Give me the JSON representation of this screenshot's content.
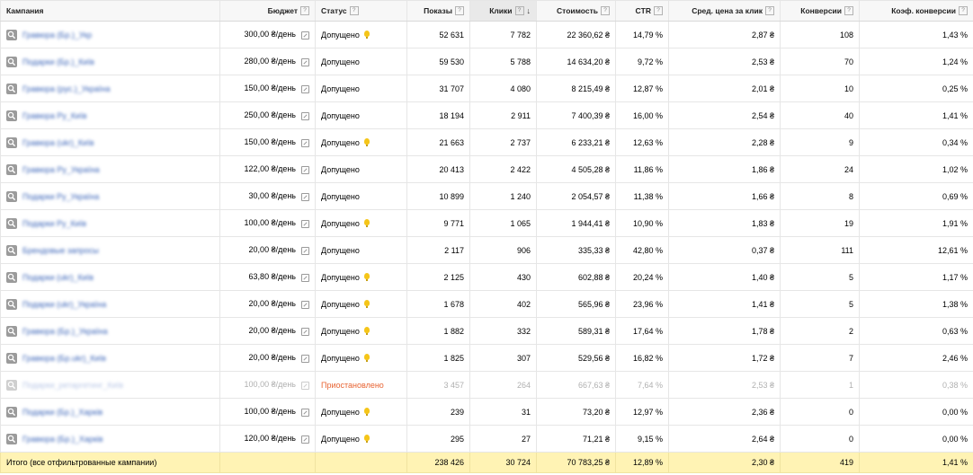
{
  "headers": {
    "campaign": "Кампания",
    "budget": "Бюджет",
    "status": "Статус",
    "impressions": "Показы",
    "clicks": "Клики",
    "cost": "Стоимость",
    "ctr": "CTR",
    "avg_cpc": "Сред. цена за клик",
    "conversions": "Конверсии",
    "conv_rate": "Коэф. конверсии",
    "help_mark": "?",
    "sort_arrow": "↓"
  },
  "icons": {
    "search": "search-icon",
    "edit": "pencil-edit-icon",
    "bulb": "lightbulb-icon"
  },
  "colors": {
    "link": "#3a64b8",
    "paused_status": "#e86433",
    "total_row": "#fff3b4",
    "bulb": "#f5c518"
  },
  "rows": [
    {
      "name": "Гравюра (Бр.)_Укр",
      "budget": "300,00 ₴/день",
      "status": "Допущено",
      "bulb": true,
      "impressions": "52 631",
      "clicks": "7 782",
      "cost": "22 360,62 ₴",
      "ctr": "14,79 %",
      "cpc": "2,87 ₴",
      "conv": "108",
      "rate": "1,43 %",
      "paused": false
    },
    {
      "name": "Подарки (Бр.)_Київ",
      "budget": "280,00 ₴/день",
      "status": "Допущено",
      "bulb": false,
      "impressions": "59 530",
      "clicks": "5 788",
      "cost": "14 634,20 ₴",
      "ctr": "9,72 %",
      "cpc": "2,53 ₴",
      "conv": "70",
      "rate": "1,24 %",
      "paused": false
    },
    {
      "name": "Гравюра (рус.)_Україна",
      "budget": "150,00 ₴/день",
      "status": "Допущено",
      "bulb": false,
      "impressions": "31 707",
      "clicks": "4 080",
      "cost": "8 215,49 ₴",
      "ctr": "12,87 %",
      "cpc": "2,01 ₴",
      "conv": "10",
      "rate": "0,25 %",
      "paused": false
    },
    {
      "name": "Гравюра Ру_Київ",
      "budget": "250,00 ₴/день",
      "status": "Допущено",
      "bulb": false,
      "impressions": "18 194",
      "clicks": "2 911",
      "cost": "7 400,39 ₴",
      "ctr": "16,00 %",
      "cpc": "2,54 ₴",
      "conv": "40",
      "rate": "1,41 %",
      "paused": false
    },
    {
      "name": "Гравюра (ukr)_Київ",
      "budget": "150,00 ₴/день",
      "status": "Допущено",
      "bulb": true,
      "impressions": "21 663",
      "clicks": "2 737",
      "cost": "6 233,21 ₴",
      "ctr": "12,63 %",
      "cpc": "2,28 ₴",
      "conv": "9",
      "rate": "0,34 %",
      "paused": false
    },
    {
      "name": "Гравюра Ру_Україна",
      "budget": "122,00 ₴/день",
      "status": "Допущено",
      "bulb": false,
      "impressions": "20 413",
      "clicks": "2 422",
      "cost": "4 505,28 ₴",
      "ctr": "11,86 %",
      "cpc": "1,86 ₴",
      "conv": "24",
      "rate": "1,02 %",
      "paused": false
    },
    {
      "name": "Подарки Ру_Україна",
      "budget": "30,00 ₴/день",
      "status": "Допущено",
      "bulb": false,
      "impressions": "10 899",
      "clicks": "1 240",
      "cost": "2 054,57 ₴",
      "ctr": "11,38 %",
      "cpc": "1,66 ₴",
      "conv": "8",
      "rate": "0,69 %",
      "paused": false
    },
    {
      "name": "Подарки Ру_Київ",
      "budget": "100,00 ₴/день",
      "status": "Допущено",
      "bulb": true,
      "impressions": "9 771",
      "clicks": "1 065",
      "cost": "1 944,41 ₴",
      "ctr": "10,90 %",
      "cpc": "1,83 ₴",
      "conv": "19",
      "rate": "1,91 %",
      "paused": false
    },
    {
      "name": "Брендовые запросы",
      "budget": "20,00 ₴/день",
      "status": "Допущено",
      "bulb": false,
      "impressions": "2 117",
      "clicks": "906",
      "cost": "335,33 ₴",
      "ctr": "42,80 %",
      "cpc": "0,37 ₴",
      "conv": "111",
      "rate": "12,61 %",
      "paused": false
    },
    {
      "name": "Подарки (ukr)_Київ",
      "budget": "63,80 ₴/день",
      "status": "Допущено",
      "bulb": true,
      "impressions": "2 125",
      "clicks": "430",
      "cost": "602,88 ₴",
      "ctr": "20,24 %",
      "cpc": "1,40 ₴",
      "conv": "5",
      "rate": "1,17 %",
      "paused": false
    },
    {
      "name": "Подарки (ukr)_Україна",
      "budget": "20,00 ₴/день",
      "status": "Допущено",
      "bulb": true,
      "impressions": "1 678",
      "clicks": "402",
      "cost": "565,96 ₴",
      "ctr": "23,96 %",
      "cpc": "1,41 ₴",
      "conv": "5",
      "rate": "1,38 %",
      "paused": false
    },
    {
      "name": "Гравюра (Бр.)_Україна",
      "budget": "20,00 ₴/день",
      "status": "Допущено",
      "bulb": true,
      "impressions": "1 882",
      "clicks": "332",
      "cost": "589,31 ₴",
      "ctr": "17,64 %",
      "cpc": "1,78 ₴",
      "conv": "2",
      "rate": "0,63 %",
      "paused": false
    },
    {
      "name": "Гравюра (Бр.ukr)_Київ",
      "budget": "20,00 ₴/день",
      "status": "Допущено",
      "bulb": true,
      "impressions": "1 825",
      "clicks": "307",
      "cost": "529,56 ₴",
      "ctr": "16,82 %",
      "cpc": "1,72 ₴",
      "conv": "7",
      "rate": "2,46 %",
      "paused": false
    },
    {
      "name": "Подарки_ретаргетинг_Київ",
      "budget": "100,00 ₴/день",
      "status": "Приостановлено",
      "bulb": false,
      "impressions": "3 457",
      "clicks": "264",
      "cost": "667,63 ₴",
      "ctr": "7,64 %",
      "cpc": "2,53 ₴",
      "conv": "1",
      "rate": "0,38 %",
      "paused": true
    },
    {
      "name": "Подарки (Бр.)_Харків",
      "budget": "100,00 ₴/день",
      "status": "Допущено",
      "bulb": true,
      "impressions": "239",
      "clicks": "31",
      "cost": "73,20 ₴",
      "ctr": "12,97 %",
      "cpc": "2,36 ₴",
      "conv": "0",
      "rate": "0,00 %",
      "paused": false
    },
    {
      "name": "Гравюра (Бр.)_Харків",
      "budget": "120,00 ₴/день",
      "status": "Допущено",
      "bulb": true,
      "impressions": "295",
      "clicks": "27",
      "cost": "71,21 ₴",
      "ctr": "9,15 %",
      "cpc": "2,64 ₴",
      "conv": "0",
      "rate": "0,00 %",
      "paused": false
    }
  ],
  "total": {
    "label": "Итого (все отфильтрованные кампании)",
    "impressions": "238 426",
    "clicks": "30 724",
    "cost": "70 783,25 ₴",
    "ctr": "12,89 %",
    "cpc": "2,30 ₴",
    "conv": "419",
    "rate": "1,41 %"
  }
}
